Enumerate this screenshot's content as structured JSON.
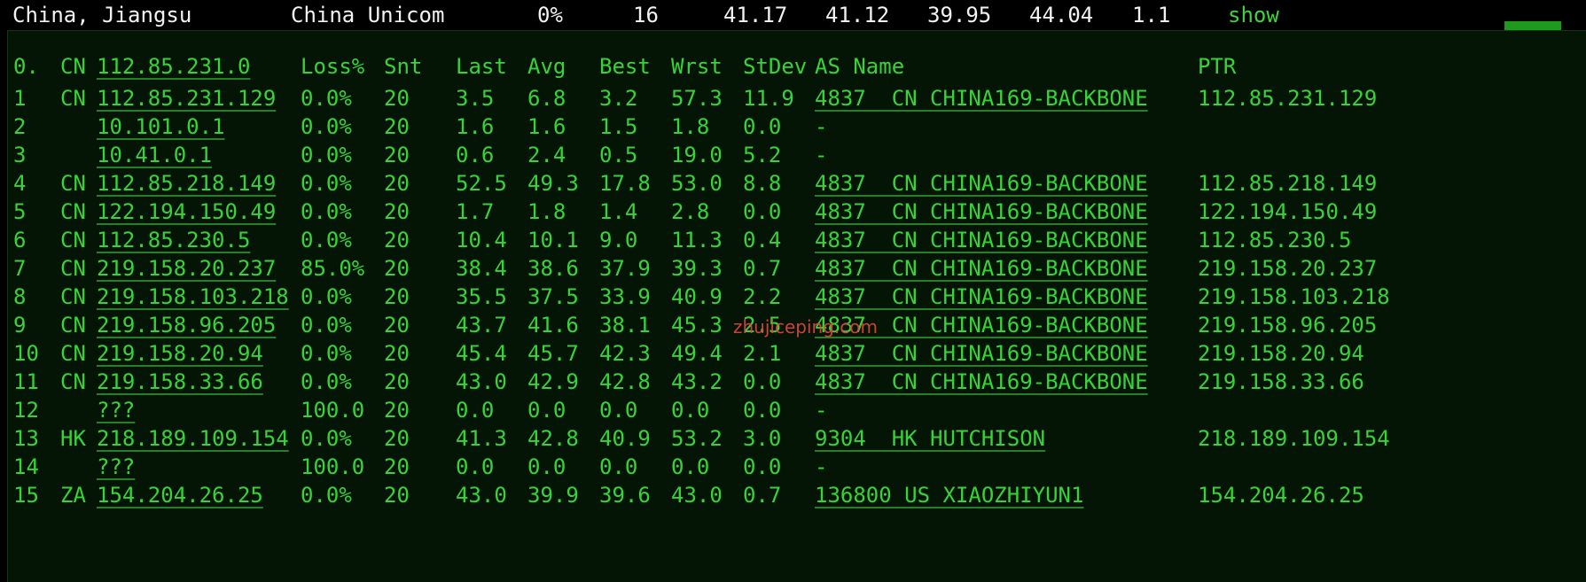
{
  "summary": {
    "location": "China, Jiangsu",
    "isp": "China Unicom",
    "loss": "0%",
    "sent": "16",
    "last": "41.17",
    "avg": "41.12",
    "best": "39.95",
    "worst": "44.04",
    "stdev": "1.1",
    "show_label": "show"
  },
  "table": {
    "header": {
      "num": "0.",
      "cc": "CN",
      "host": "112.85.231.0",
      "loss": "Loss%",
      "snt": "Snt",
      "last": "Last",
      "avg": "Avg",
      "best": "Best",
      "wrst": "Wrst",
      "stdev": "StDev",
      "as": "AS Name",
      "ptr": "PTR"
    },
    "rows": [
      {
        "num": "1",
        "cc": "CN",
        "host": "112.85.231.129",
        "loss": "0.0%",
        "snt": "20",
        "last": "3.5",
        "avg": "6.8",
        "best": "3.2",
        "wrst": "57.3",
        "stdev": "11.9",
        "as": "4837  CN CHINA169-BACKBONE",
        "ptr": "112.85.231.129"
      },
      {
        "num": "2",
        "cc": "",
        "host": "10.101.0.1",
        "loss": "0.0%",
        "snt": "20",
        "last": "1.6",
        "avg": "1.6",
        "best": "1.5",
        "wrst": "1.8",
        "stdev": "0.0",
        "as": "-",
        "ptr": ""
      },
      {
        "num": "3",
        "cc": "",
        "host": "10.41.0.1",
        "loss": "0.0%",
        "snt": "20",
        "last": "0.6",
        "avg": "2.4",
        "best": "0.5",
        "wrst": "19.0",
        "stdev": "5.2",
        "as": "-",
        "ptr": ""
      },
      {
        "num": "4",
        "cc": "CN",
        "host": "112.85.218.149",
        "loss": "0.0%",
        "snt": "20",
        "last": "52.5",
        "avg": "49.3",
        "best": "17.8",
        "wrst": "53.0",
        "stdev": "8.8",
        "as": "4837  CN CHINA169-BACKBONE",
        "ptr": "112.85.218.149"
      },
      {
        "num": "5",
        "cc": "CN",
        "host": "122.194.150.49",
        "loss": "0.0%",
        "snt": "20",
        "last": "1.7",
        "avg": "1.8",
        "best": "1.4",
        "wrst": "2.8",
        "stdev": "0.0",
        "as": "4837  CN CHINA169-BACKBONE",
        "ptr": "122.194.150.49"
      },
      {
        "num": "6",
        "cc": "CN",
        "host": "112.85.230.5",
        "loss": "0.0%",
        "snt": "20",
        "last": "10.4",
        "avg": "10.1",
        "best": "9.0",
        "wrst": "11.3",
        "stdev": "0.4",
        "as": "4837  CN CHINA169-BACKBONE",
        "ptr": "112.85.230.5"
      },
      {
        "num": "7",
        "cc": "CN",
        "host": "219.158.20.237",
        "loss": "85.0%",
        "snt": "20",
        "last": "38.4",
        "avg": "38.6",
        "best": "37.9",
        "wrst": "39.3",
        "stdev": "0.7",
        "as": "4837  CN CHINA169-BACKBONE",
        "ptr": "219.158.20.237"
      },
      {
        "num": "8",
        "cc": "CN",
        "host": "219.158.103.218",
        "loss": "0.0%",
        "snt": "20",
        "last": "35.5",
        "avg": "37.5",
        "best": "33.9",
        "wrst": "40.9",
        "stdev": "2.2",
        "as": "4837  CN CHINA169-BACKBONE",
        "ptr": "219.158.103.218"
      },
      {
        "num": "9",
        "cc": "CN",
        "host": "219.158.96.205",
        "loss": "0.0%",
        "snt": "20",
        "last": "43.7",
        "avg": "41.6",
        "best": "38.1",
        "wrst": "45.3",
        "stdev": "2.5",
        "as": "4837  CN CHINA169-BACKBONE",
        "ptr": "219.158.96.205"
      },
      {
        "num": "10",
        "cc": "CN",
        "host": "219.158.20.94",
        "loss": "0.0%",
        "snt": "20",
        "last": "45.4",
        "avg": "45.7",
        "best": "42.3",
        "wrst": "49.4",
        "stdev": "2.1",
        "as": "4837  CN CHINA169-BACKBONE",
        "ptr": "219.158.20.94"
      },
      {
        "num": "11",
        "cc": "CN",
        "host": "219.158.33.66",
        "loss": "0.0%",
        "snt": "20",
        "last": "43.0",
        "avg": "42.9",
        "best": "42.8",
        "wrst": "43.2",
        "stdev": "0.0",
        "as": "4837  CN CHINA169-BACKBONE",
        "ptr": "219.158.33.66"
      },
      {
        "num": "12",
        "cc": "",
        "host": "???",
        "loss": "100.0",
        "snt": "20",
        "last": "0.0",
        "avg": "0.0",
        "best": "0.0",
        "wrst": "0.0",
        "stdev": "0.0",
        "as": "-",
        "ptr": ""
      },
      {
        "num": "13",
        "cc": "HK",
        "host": "218.189.109.154",
        "loss": "0.0%",
        "snt": "20",
        "last": "41.3",
        "avg": "42.8",
        "best": "40.9",
        "wrst": "53.2",
        "stdev": "3.0",
        "as": "9304  HK HUTCHISON",
        "ptr": "218.189.109.154"
      },
      {
        "num": "14",
        "cc": "",
        "host": "???",
        "loss": "100.0",
        "snt": "20",
        "last": "0.0",
        "avg": "0.0",
        "best": "0.0",
        "wrst": "0.0",
        "stdev": "0.0",
        "as": "-",
        "ptr": ""
      },
      {
        "num": "15",
        "cc": "ZA",
        "host": "154.204.26.25",
        "loss": "0.0%",
        "snt": "20",
        "last": "43.0",
        "avg": "39.9",
        "best": "39.6",
        "wrst": "43.0",
        "stdev": "0.7",
        "as": "136800 US XIAOZHIYUN1",
        "ptr": "154.204.26.25"
      }
    ]
  },
  "watermark": "zhujiceping.com",
  "colors": {
    "background": "#000000",
    "panel": "#051505",
    "text_green": "#37d437",
    "text_white": "#f2f2f2",
    "watermark": "#e8453c"
  }
}
